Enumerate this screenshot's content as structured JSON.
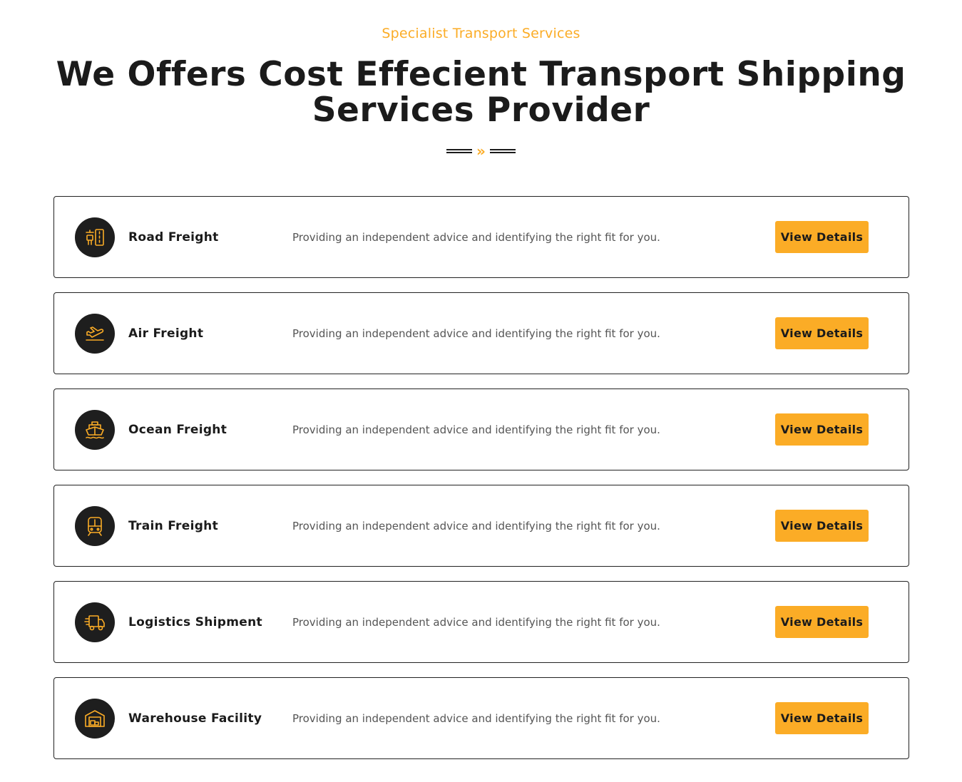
{
  "header": {
    "eyebrow": "Specialist Transport Services",
    "title": "We Offers Cost Effecient Transport Shipping Services Provider",
    "divider_arrows": "»"
  },
  "colors": {
    "accent": "#fbac26",
    "dark": "#1b1b1b",
    "text_muted": "#555555"
  },
  "services": [
    {
      "name": "Road Freight",
      "icon": "road-freight-icon",
      "description": "Providing an independent advice and identifying the right fit for you.",
      "button": "View Details"
    },
    {
      "name": "Air Freight",
      "icon": "airplane-icon",
      "description": "Providing an independent advice and identifying the right fit for you.",
      "button": "View Details"
    },
    {
      "name": "Ocean Freight",
      "icon": "ship-icon",
      "description": "Providing an independent advice and identifying the right fit for you.",
      "button": "View Details"
    },
    {
      "name": "Train Freight",
      "icon": "train-icon",
      "description": "Providing an independent advice and identifying the right fit for you.",
      "button": "View Details"
    },
    {
      "name": "Logistics Shipment",
      "icon": "delivery-truck-icon",
      "description": "Providing an independent advice and identifying the right fit for you.",
      "button": "View Details"
    },
    {
      "name": "Warehouse Facility",
      "icon": "warehouse-icon",
      "description": "Providing an independent advice and identifying the right fit for you.",
      "button": "View Details"
    }
  ]
}
